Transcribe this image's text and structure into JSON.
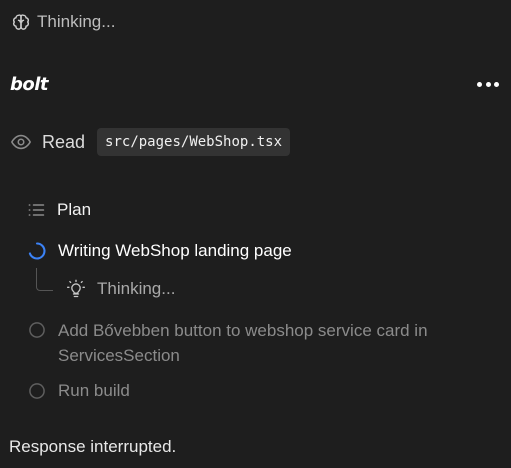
{
  "header": {
    "thinking_label": "Thinking...",
    "icon": "brain-icon"
  },
  "chat": {
    "brand": "bolt",
    "menu_icon": "more-horizontal-icon"
  },
  "read_action": {
    "label": "Read",
    "file": "src/pages/WebShop.tsx",
    "icon": "eye-icon"
  },
  "plan": {
    "label": "Plan",
    "icon": "list-icon",
    "tasks": [
      {
        "label": "Writing WebShop landing page",
        "status": "in-progress",
        "icon": "spinner-icon"
      },
      {
        "label": "Add Bővebben button to webshop service card in ServicesSection",
        "status": "pending",
        "icon": "circle-icon"
      },
      {
        "label": "Run build",
        "status": "pending",
        "icon": "circle-icon"
      }
    ],
    "subtask": {
      "label": "Thinking...",
      "icon": "lightbulb-icon"
    }
  },
  "status": {
    "message": "Response interrupted."
  },
  "colors": {
    "background": "#1e1e1e",
    "accent_spinner": "#3b82f6",
    "code_bg": "#333333"
  }
}
